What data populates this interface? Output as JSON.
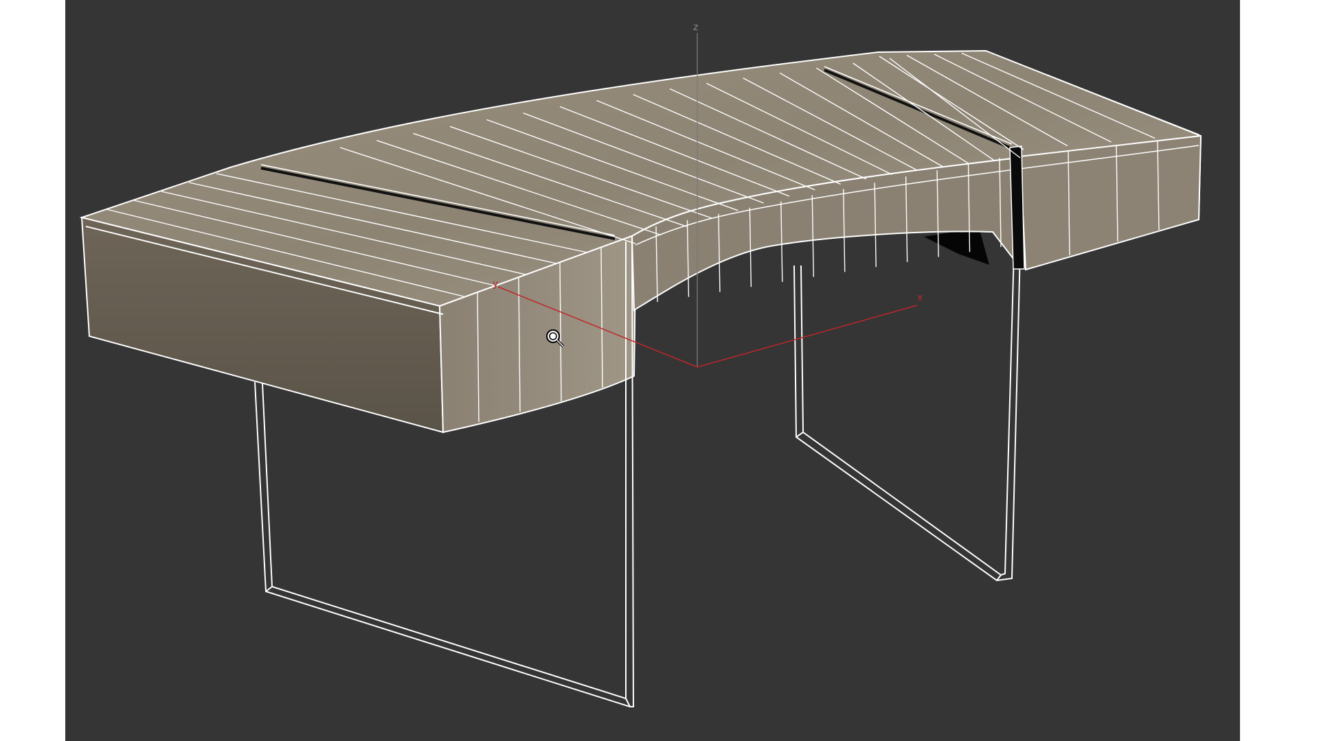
{
  "viewport": {
    "background": "#353535",
    "wire_color": "#ffffff",
    "wood_color": "#8a8072",
    "wood_dark": "#5e574c",
    "gap_color": "#0a0a0a"
  },
  "gizmo": {
    "x_label": "x",
    "y_label": "y",
    "z_label": "z",
    "xy_color": "#c0262a",
    "z_color": "#7a7a7a"
  },
  "cursor": {
    "icon": "zoom-magnifier-icon"
  }
}
